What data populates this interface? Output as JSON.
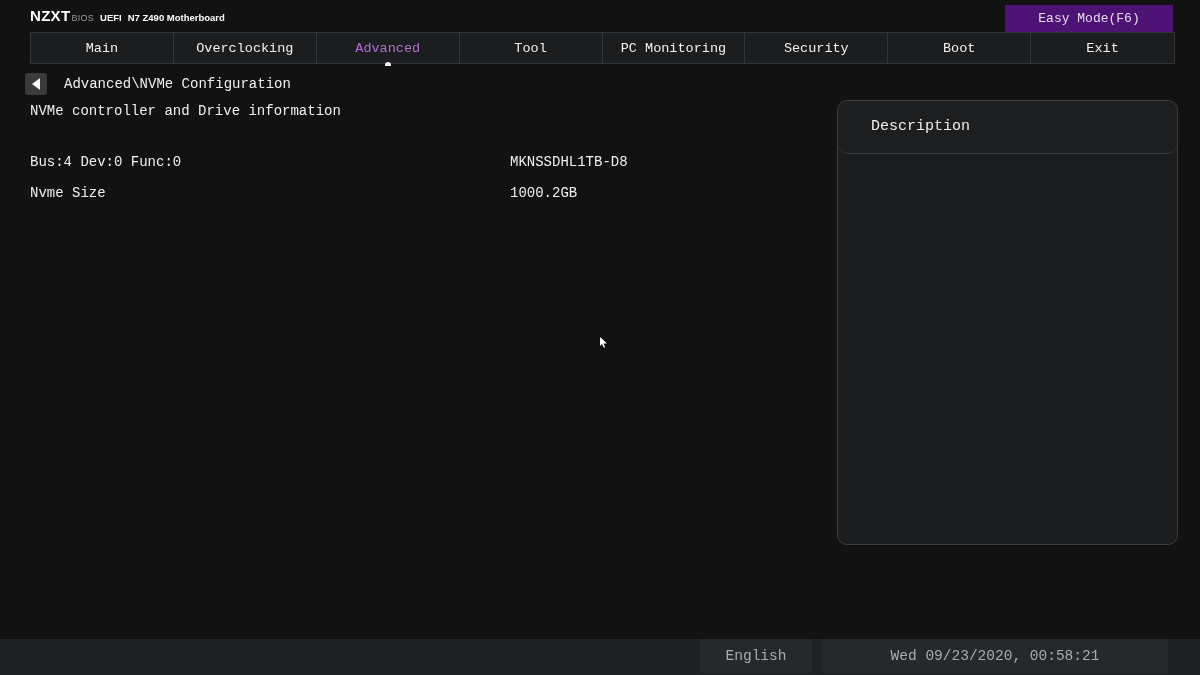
{
  "header": {
    "brand": "NZXT",
    "product": "BIOS",
    "firmware": "UEFI",
    "board": "N7 Z490 Motherboard",
    "mode_button": "Easy Mode(F6)"
  },
  "tabs": [
    {
      "label": "Main",
      "selected": false
    },
    {
      "label": "Overclocking",
      "selected": false
    },
    {
      "label": "Advanced",
      "selected": true
    },
    {
      "label": "Tool",
      "selected": false
    },
    {
      "label": "PC Monitoring",
      "selected": false
    },
    {
      "label": "Security",
      "selected": false
    },
    {
      "label": "Boot",
      "selected": false
    },
    {
      "label": "Exit",
      "selected": false
    }
  ],
  "breadcrumb": {
    "path": "Advanced\\NVMe Configuration"
  },
  "section_title": "NVMe controller and Drive information",
  "rows": [
    {
      "label": "Bus:4 Dev:0 Func:0",
      "value": "MKNSSDHL1TB-D8"
    },
    {
      "label": "Nvme Size",
      "value": "1000.2GB"
    }
  ],
  "description_panel": {
    "title": "Description"
  },
  "status_bar": {
    "language": "English",
    "datetime": "Wed 09/23/2020, 00:58:21"
  }
}
